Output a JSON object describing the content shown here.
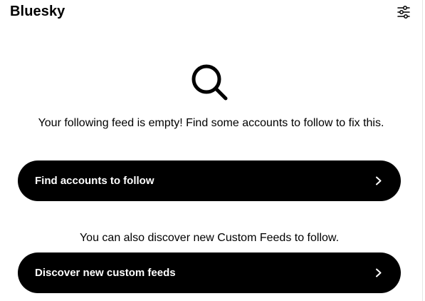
{
  "header": {
    "title": "Bluesky",
    "settings_icon": "sliders-icon"
  },
  "empty_state": {
    "icon": "search-icon",
    "message": "Your following feed is empty! Find some accounts to follow to fix this.",
    "find_accounts_label": "Find accounts to follow",
    "secondary_message": "You can also discover new Custom Feeds to follow.",
    "discover_feeds_label": "Discover new custom feeds",
    "chevron_icon": "chevron-right-icon"
  },
  "colors": {
    "background": "#ffffff",
    "button_background": "#000000",
    "button_text": "#ffffff",
    "text": "#000000"
  }
}
